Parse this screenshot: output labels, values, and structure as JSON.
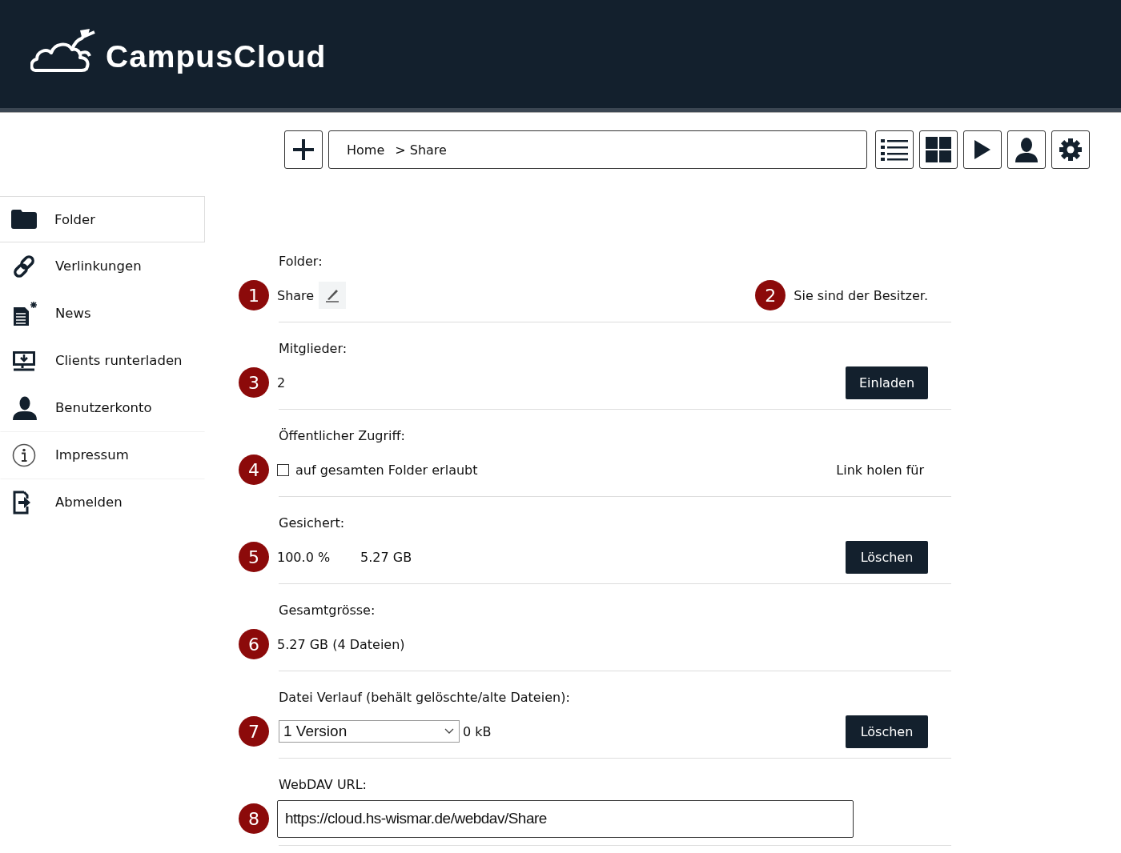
{
  "header": {
    "logo_text": "CampusCloud"
  },
  "toolbar": {
    "breadcrumb": [
      {
        "label": "Home"
      },
      {
        "label": "> Share"
      }
    ]
  },
  "sidebar": {
    "items": [
      {
        "label": "Folder",
        "selected": true
      },
      {
        "label": "Verlinkungen",
        "selected": false
      },
      {
        "label": "News",
        "selected": false
      },
      {
        "label": "Clients runterladen",
        "selected": false
      },
      {
        "label": "Benutzerkonto",
        "selected": false
      },
      {
        "label": "Impressum",
        "selected": false
      },
      {
        "label": "Abmelden",
        "selected": false
      }
    ]
  },
  "sections": [
    {
      "kind": "name",
      "label": "Folder:",
      "badge": "1",
      "value": "Share",
      "right_badge": "2",
      "right_text": "Sie sind der Besitzer."
    },
    {
      "kind": "button",
      "label": "Mitglieder:",
      "badge": "3",
      "value": "2",
      "button": "Einladen"
    },
    {
      "kind": "checkbox",
      "label": "Öffentlicher Zugriff:",
      "badge": "4",
      "checked": false,
      "value": "auf gesamten Folder erlaubt",
      "right_text": "Link holen für"
    },
    {
      "kind": "button",
      "label": "Gesichert:",
      "badge": "5",
      "value": "100.0 %",
      "value_2": "5.27 GB",
      "button": "Löschen"
    },
    {
      "kind": "text",
      "label": "Gesamtgrösse:",
      "badge": "6",
      "value": "5.27 GB (4 Dateien)"
    },
    {
      "kind": "select",
      "label": "Datei Verlauf (behält gelöschte/alte Dateien):",
      "badge": "7",
      "selected_option": "1 Version",
      "value": "0 kB",
      "button": "Löschen"
    },
    {
      "kind": "url",
      "label": "WebDAV URL:",
      "badge": "8",
      "value": "https://cloud.hs-wismar.de/webdav/Share"
    }
  ]
}
